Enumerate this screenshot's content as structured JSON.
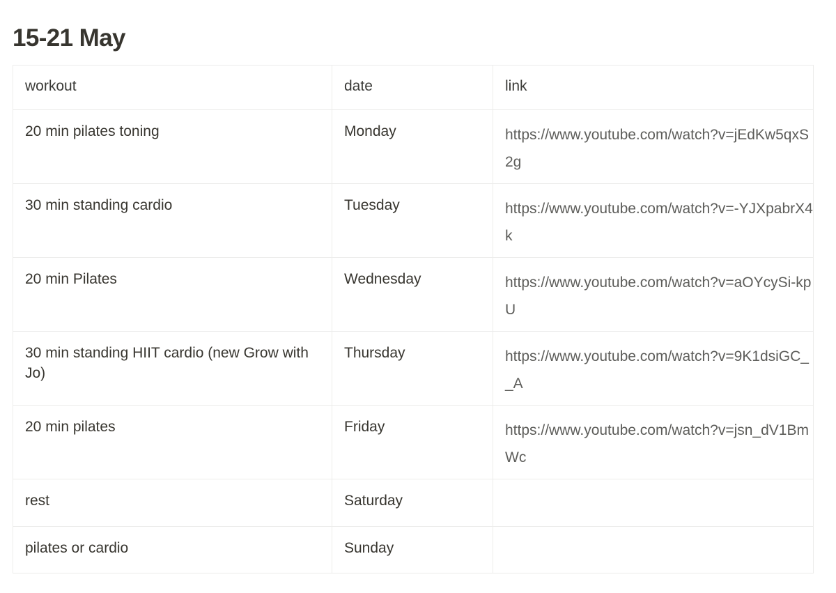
{
  "page": {
    "title": "15-21 May"
  },
  "table": {
    "columns": [
      "workout",
      "date",
      "link"
    ],
    "rows": [
      {
        "workout": "20 min pilates toning",
        "date": "Monday",
        "link": "https://www.youtube.com/watch?v=jEdKw5qxS2g"
      },
      {
        "workout": "30 min standing cardio",
        "date": "Tuesday",
        "link": "https://www.youtube.com/watch?v=-YJXpabrX4k"
      },
      {
        "workout": "20 min Pilates",
        "date": "Wednesday",
        "link": "https://www.youtube.com/watch?v=aOYcySi-kpU"
      },
      {
        "workout": "30 min standing HIIT cardio (new Grow with Jo)",
        "date": "Thursday",
        "link": "https://www.youtube.com/watch?v=9K1dsiGC__A"
      },
      {
        "workout": "20 min pilates",
        "date": "Friday",
        "link": "https://www.youtube.com/watch?v=jsn_dV1BmWc"
      },
      {
        "workout": "rest",
        "date": "Saturday",
        "link": ""
      },
      {
        "workout": "pilates or cardio",
        "date": "Sunday",
        "link": ""
      }
    ]
  },
  "colors": {
    "text": "#37352f",
    "link": "#5d5d5a",
    "border": "#ececeb",
    "background": "#ffffff"
  }
}
